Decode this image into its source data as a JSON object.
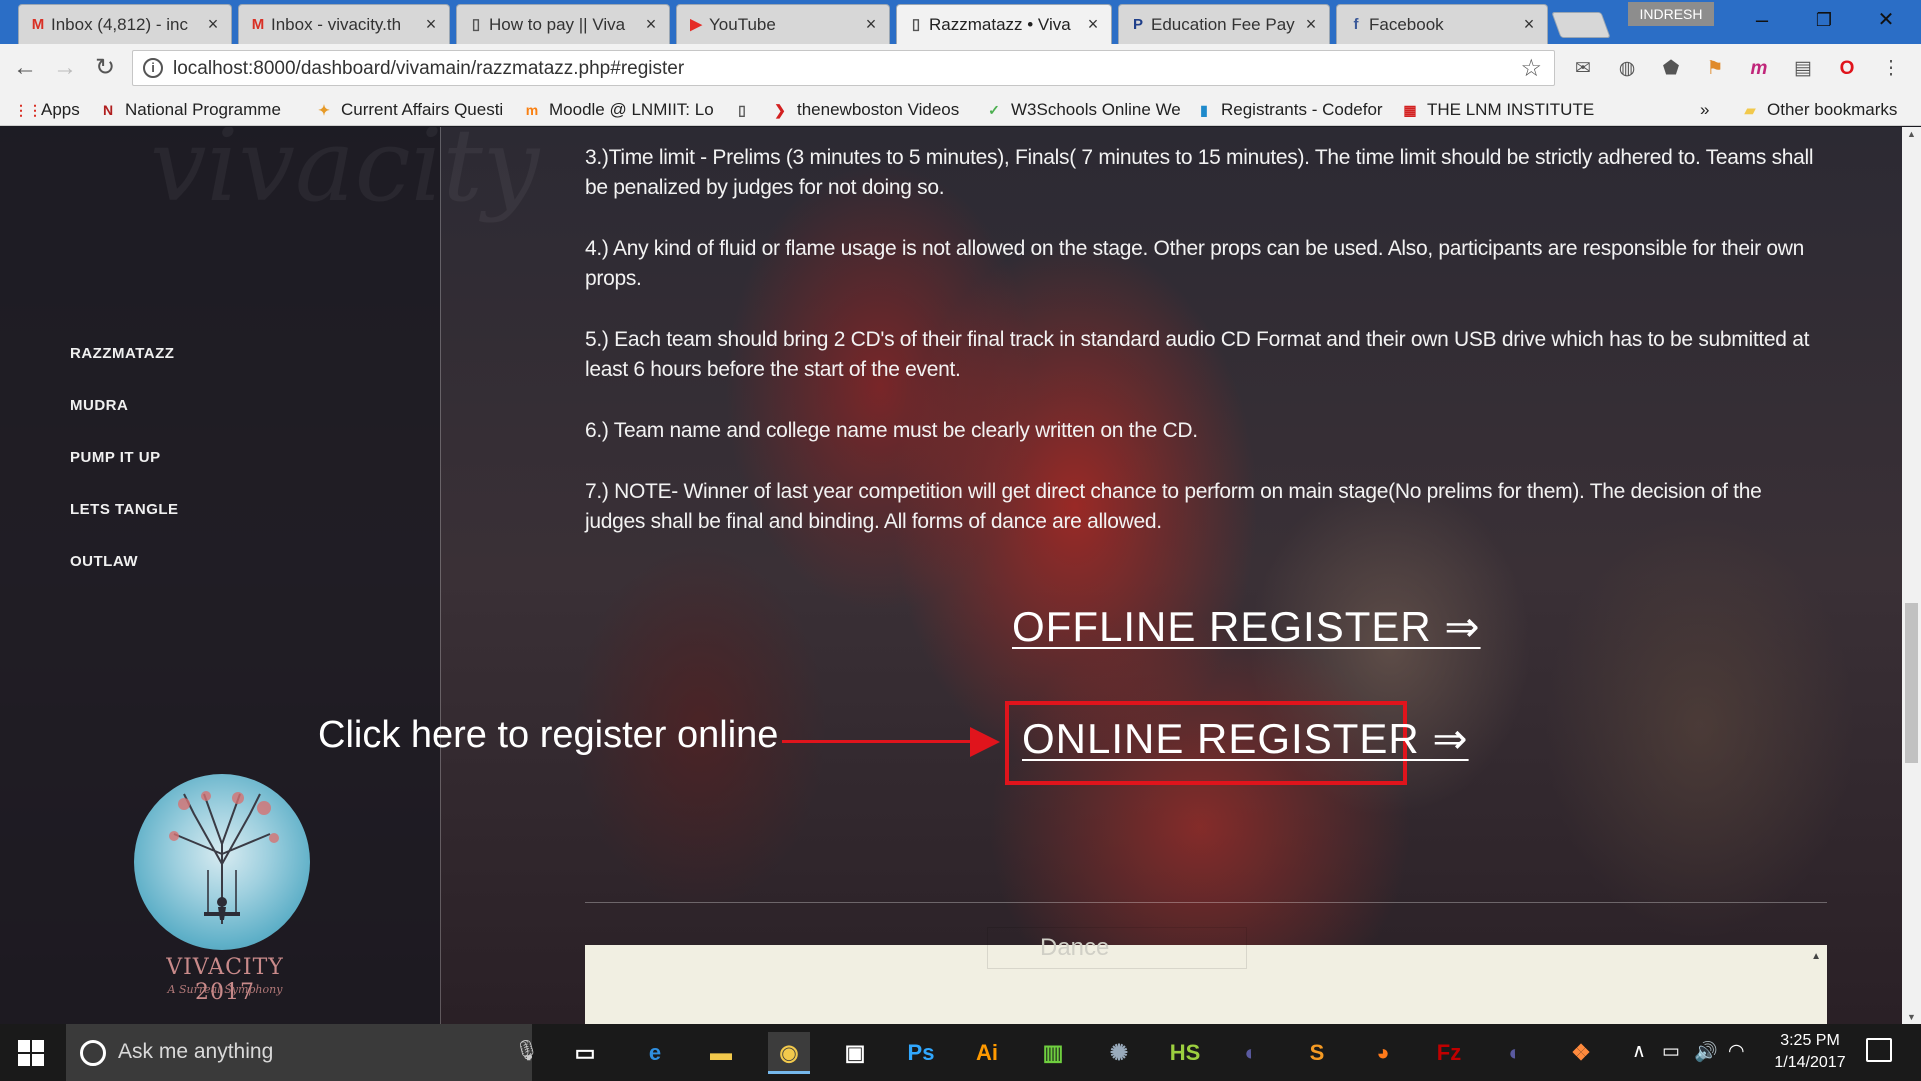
{
  "tabs": [
    {
      "title": "Inbox (4,812) - inc",
      "icon": "gmail-icon",
      "glyph": "M",
      "color": "#d93025",
      "active": false
    },
    {
      "title": "Inbox - vivacity.th",
      "icon": "gmail-icon",
      "glyph": "M",
      "color": "#d93025",
      "active": false
    },
    {
      "title": "How to pay || Viva",
      "icon": "page-icon",
      "glyph": "▯",
      "color": "#555555",
      "active": false
    },
    {
      "title": "YouTube",
      "icon": "youtube-icon",
      "glyph": "▶",
      "color": "#e52d27",
      "active": false
    },
    {
      "title": "Razzmatazz • Viva",
      "icon": "page-icon",
      "glyph": "▯",
      "color": "#555555",
      "active": true
    },
    {
      "title": "Education Fee Pay",
      "icon": "paytm-icon",
      "glyph": "P",
      "color": "#1f3f8a",
      "active": false
    },
    {
      "title": "Facebook",
      "icon": "facebook-icon",
      "glyph": "f",
      "color": "#3b5998",
      "active": false
    }
  ],
  "profile_name": "INDRESH",
  "window_controls": {
    "minimize": "–",
    "restore": "❐",
    "close": "✕"
  },
  "address_bar": {
    "url": "localhost:8000/dashboard/vivamain/razzmatazz.php#register"
  },
  "bookmarks": [
    {
      "label": "Apps",
      "icon": "apps-grid-icon",
      "glyph": "⋮⋮",
      "color": "#d93025"
    },
    {
      "label": "National Programme",
      "icon": "nptel-icon",
      "glyph": "N",
      "color": "#b01e1e"
    },
    {
      "label": "Current Affairs Questi",
      "icon": "ribbon-icon",
      "glyph": "✦",
      "color": "#e69a28"
    },
    {
      "label": "Moodle @ LNMIIT: Lo",
      "icon": "moodle-icon",
      "glyph": "m",
      "color": "#f98012"
    },
    {
      "label": "",
      "icon": "page-icon",
      "glyph": "▯",
      "color": "#555555"
    },
    {
      "label": "thenewboston Videos",
      "icon": "thenewboston-icon",
      "glyph": "❯",
      "color": "#d32020"
    },
    {
      "label": "W3Schools Online We",
      "icon": "w3schools-icon",
      "glyph": "✓",
      "color": "#4caf50"
    },
    {
      "label": "Registrants - Codefor",
      "icon": "codeforces-icon",
      "glyph": "▮",
      "color": "#1f8acb"
    },
    {
      "label": "THE LNM INSTITUTE C",
      "icon": "lnmiit-icon",
      "glyph": "▦",
      "color": "#d32020"
    }
  ],
  "bookmarks_more": "»",
  "other_bookmarks": "Other bookmarks",
  "page": {
    "background_word": "vivacity",
    "menu": [
      "RAZZMATAZZ",
      "MUDRA",
      "PUMP IT UP",
      "LETS TANGLE",
      "OUTLAW"
    ],
    "rules": [
      "3.)Time limit - Prelims (3 minutes to 5 minutes), Finals( 7 minutes to 15 minutes). The time limit should be strictly adhered to. Teams shall be penalized by judges for not doing so.",
      "4.) Any kind of fluid or flame usage is not allowed on the stage. Other props can be used. Also, participants are responsible for their own props.",
      "5.) Each team should bring 2 CD's of their final track in standard audio CD Format and their own USB drive which has to be submitted at least 6 hours before the start of the event.",
      "6.) Team name and college name must be clearly written on the CD.",
      "7.) NOTE- Winner of last year competition will get direct chance to perform on main stage(No prelims for them). The decision of the judges shall be final and binding. All forms of dance are allowed."
    ],
    "offline_register": "OFFLINE REGISTER ⇒",
    "online_register": "ONLINE REGISTER ⇒",
    "annotation": "Click here to register online",
    "annotation_color": "#e0141c",
    "logo_name": "VIVACITY 2017",
    "logo_tagline": "A Surreal Symphony",
    "form_field_value": "Dance"
  },
  "taskbar": {
    "search_placeholder": "Ask me anything",
    "apps": [
      {
        "icon": "task-view-icon",
        "glyph": "▭",
        "color": "#ffffff"
      },
      {
        "icon": "edge-icon",
        "glyph": "e",
        "color": "#2f8fe0"
      },
      {
        "icon": "file-explorer-icon",
        "glyph": "▬",
        "color": "#f2c94c"
      },
      {
        "icon": "chrome-icon",
        "glyph": "◉",
        "color": "#f2c94c",
        "selected": true
      },
      {
        "icon": "store-icon",
        "glyph": "▣",
        "color": "#ffffff"
      },
      {
        "icon": "photoshop-icon",
        "glyph": "Ps",
        "color": "#31a8ff"
      },
      {
        "icon": "illustrator-icon",
        "glyph": "Ai",
        "color": "#ff9a00"
      },
      {
        "icon": "spreadsheet-icon",
        "glyph": "▥",
        "color": "#6fcf3f"
      },
      {
        "icon": "network-app-icon",
        "glyph": "✺",
        "color": "#9ab"
      },
      {
        "icon": "hs-app-icon",
        "glyph": "HS",
        "color": "#9ccf3f"
      },
      {
        "icon": "eclipse-icon",
        "glyph": "◐",
        "color": "#5a5aa0"
      },
      {
        "icon": "sublime-icon",
        "glyph": "S",
        "color": "#f59a23"
      },
      {
        "icon": "firefox-icon",
        "glyph": "◕",
        "color": "#ff7a1a"
      },
      {
        "icon": "filezilla-icon",
        "glyph": "Fz",
        "color": "#bf0000"
      },
      {
        "icon": "eclipse-alt-icon",
        "glyph": "◐",
        "color": "#5a5aa0"
      },
      {
        "icon": "codeblocks-icon",
        "glyph": "❖",
        "color": "#ff8a3d"
      }
    ],
    "time": "3:25 PM",
    "date": "1/14/2017"
  }
}
